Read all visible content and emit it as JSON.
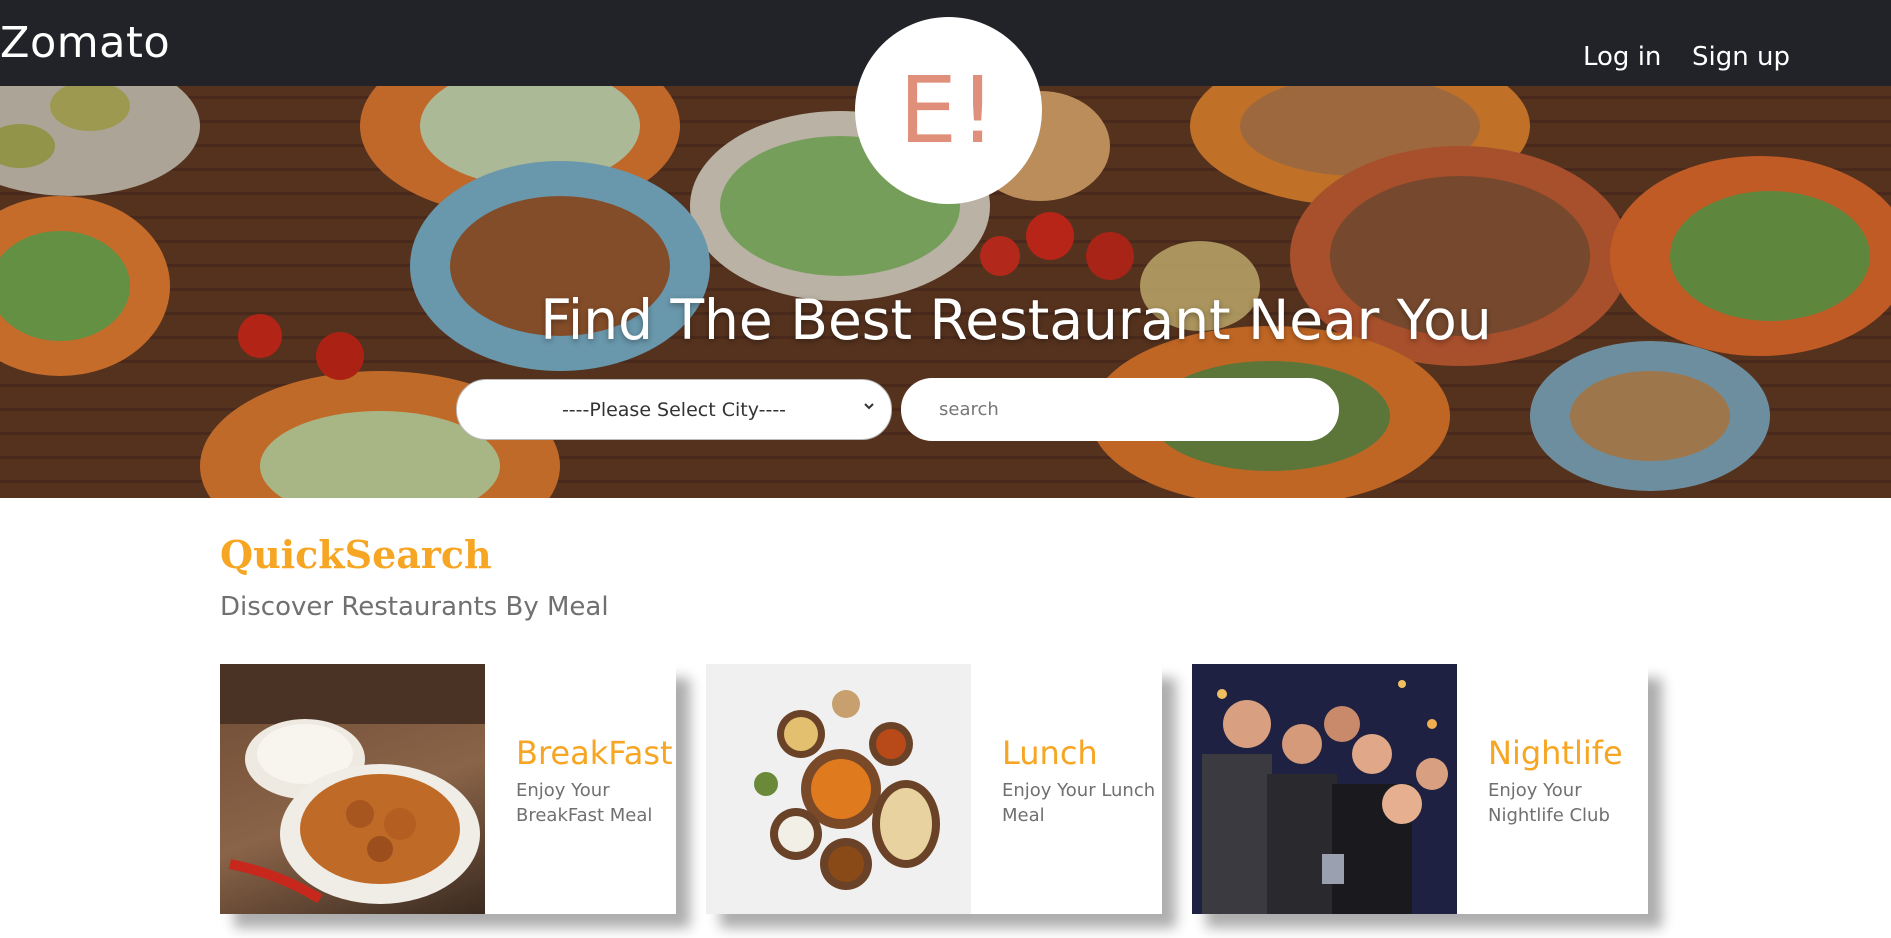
{
  "header": {
    "brand": "Zomato",
    "login_label": "Log in",
    "signup_label": "Sign up"
  },
  "hero": {
    "logo_text": "E!",
    "title": "Find The Best Restaurant Near You",
    "city_select_value": "----Please Select City----",
    "search_placeholder": "search"
  },
  "quicksearch": {
    "title": "QuickSearch",
    "subtitle": "Discover Restaurants By Meal",
    "cards": [
      {
        "title": "BreakFast",
        "desc": "Enjoy Your BreakFast Meal"
      },
      {
        "title": "Lunch",
        "desc": "Enjoy Your Lunch Meal"
      },
      {
        "title": "Nightlife",
        "desc": "Enjoy Your Nightlife Club"
      }
    ]
  },
  "colors": {
    "navbar_bg": "#222328",
    "accent_orange": "#f6a623",
    "logo_text": "#e0907a",
    "muted_text": "#707070"
  }
}
